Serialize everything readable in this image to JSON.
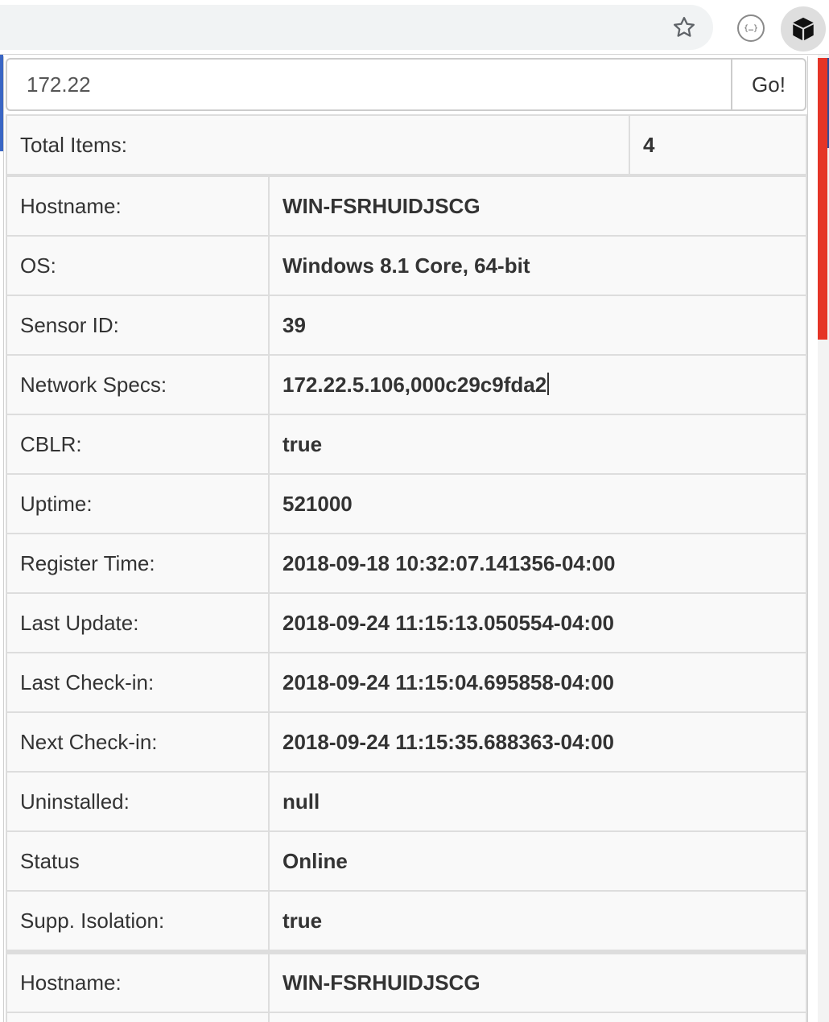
{
  "search": {
    "value": "172.22",
    "button_label": "Go!"
  },
  "summary": {
    "label": "Total Items:",
    "value": "4"
  },
  "records": [
    {
      "fields": [
        {
          "label": "Hostname:",
          "value": "WIN-FSRHUIDJSCG"
        },
        {
          "label": "OS:",
          "value": "Windows 8.1 Core, 64-bit"
        },
        {
          "label": "Sensor ID:",
          "value": "39"
        },
        {
          "label": "Network Specs:",
          "value": "172.22.5.106,000c29c9fda2"
        },
        {
          "label": "CBLR:",
          "value": "true"
        },
        {
          "label": "Uptime:",
          "value": "521000"
        },
        {
          "label": "Register Time:",
          "value": "2018-09-18 10:32:07.141356-04:00"
        },
        {
          "label": "Last Update:",
          "value": "2018-09-24 11:15:13.050554-04:00"
        },
        {
          "label": "Last Check-in:",
          "value": "2018-09-24 11:15:04.695858-04:00"
        },
        {
          "label": "Next Check-in:",
          "value": "2018-09-24 11:15:35.688363-04:00"
        },
        {
          "label": "Uninstalled:",
          "value": "null"
        },
        {
          "label": "Status",
          "value": "Online"
        },
        {
          "label": "Supp. Isolation:",
          "value": "true"
        }
      ]
    },
    {
      "fields": [
        {
          "label": "Hostname:",
          "value": "WIN-FSRHUIDJSCG"
        }
      ]
    }
  ],
  "icons": {
    "bookmark": "star-icon",
    "json_extension": "json-braces-icon",
    "active_extension": "cube-icon"
  },
  "colors": {
    "scrollbar_accent": "#e53527",
    "page_accent": "#3a66c4",
    "table_border": "#dddddd",
    "table_bg": "#f9f9f9"
  }
}
